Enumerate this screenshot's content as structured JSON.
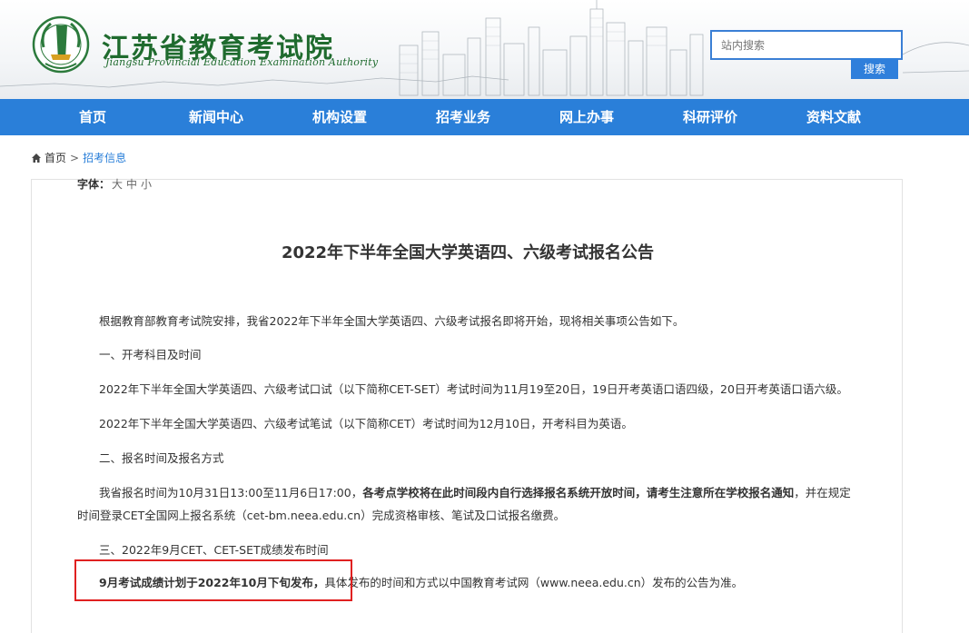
{
  "header": {
    "title": "江苏省教育考试院",
    "subtitle": "Jiangsu Provincial Education Examination Authority",
    "search_placeholder": "站内搜索",
    "search_button": "搜索"
  },
  "nav": {
    "items": [
      "首页",
      "新闻中心",
      "机构设置",
      "招考业务",
      "网上办事",
      "科研评价",
      "资料文献"
    ]
  },
  "breadcrumb": {
    "home": "首页",
    "separator": ">",
    "current": "招考信息"
  },
  "article": {
    "font_size_label": "字体：",
    "font_sizes": [
      "大",
      "中",
      "小"
    ],
    "title": "2022年下半年全国大学英语四、六级考试报名公告",
    "p1": "根据教育部教育考试院安排，我省2022年下半年全国大学英语四、六级考试报名即将开始，现将相关事项公告如下。",
    "h1": "一、开考科目及时间",
    "p2": "2022年下半年全国大学英语四、六级考试口试（以下简称CET-SET）考试时间为11月19至20日，19日开考英语口语四级，20日开考英语口语六级。",
    "p3": "2022年下半年全国大学英语四、六级考试笔试（以下简称CET）考试时间为12月10日，开考科目为英语。",
    "h2": "二、报名时间及报名方式",
    "p4_a": "我省报名时间为10月31日13:00至11月6日17:00，",
    "p4_b": "各考点学校将在此时间段内自行选择报名系统开放时间，请考生注意所在学校报名通知",
    "p4_c": "，并在规定",
    "p4_d": "时间登录CET全国网上报名系统（cet-bm.neea.edu.cn）完成资格审核、笔试及口试报名缴费。",
    "h3": "三、2022年9月CET、CET-SET成绩发布时间",
    "p5_a": "9月考试成绩计划于2022年10月下旬发布，",
    "p5_b": "具体发布的时间和方式以中国教育考试网（www.neea.edu.cn）发布的公告为准。"
  }
}
